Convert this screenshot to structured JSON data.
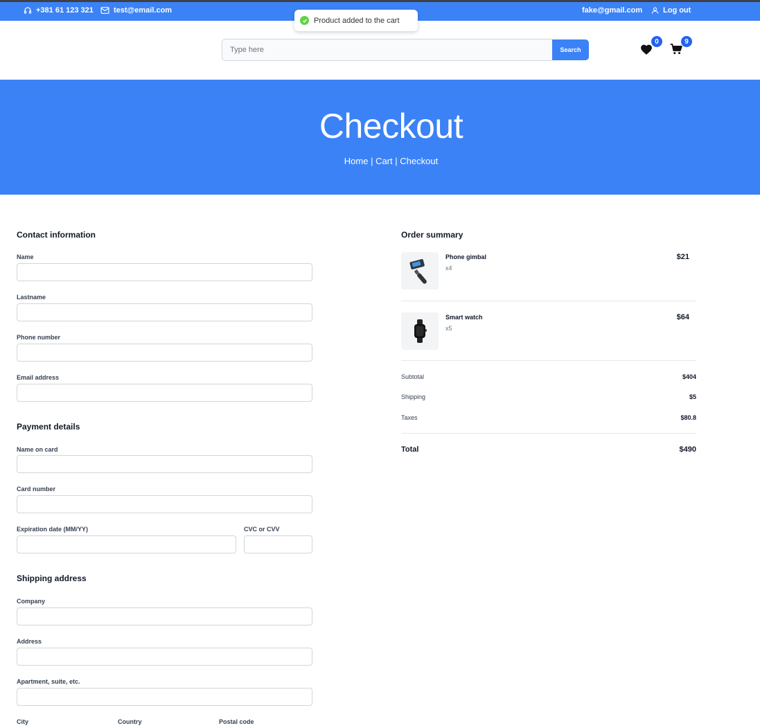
{
  "topbar": {
    "phone": "+381 61 123 321",
    "email": "test@email.com",
    "user_email": "fake@gmail.com",
    "logout": "Log out"
  },
  "toast": {
    "message": "Product added to the cart"
  },
  "search": {
    "placeholder": "Type here",
    "button": "Search"
  },
  "header": {
    "wishlist_count": "0",
    "cart_count": "9"
  },
  "hero": {
    "title": "Checkout",
    "breadcrumb": [
      "Home",
      "Cart",
      "Checkout"
    ],
    "separator": "|"
  },
  "contact": {
    "title": "Contact information",
    "fields": [
      "Name",
      "Lastname",
      "Phone number",
      "Email address"
    ]
  },
  "payment": {
    "title": "Payment details",
    "fields": [
      "Name on card",
      "Card number",
      "Expiration date (MM/YY)",
      "CVC or CVV"
    ]
  },
  "shipping": {
    "title": "Shipping address",
    "fields": [
      "Company",
      "Address",
      "Apartment, suite, etc.",
      "City",
      "Country",
      "Postal code"
    ]
  },
  "order": {
    "title": "Order summary",
    "items": [
      {
        "name": "Phone gimbal",
        "qty": "x4",
        "price": "$21"
      },
      {
        "name": "Smart watch",
        "qty": "x5",
        "price": "$64"
      }
    ],
    "subtotal_label": "Subtotal",
    "subtotal": "$404",
    "shipping_label": "Shipping",
    "shipping": "$5",
    "taxes_label": "Taxes",
    "taxes": "$80.8",
    "total_label": "Total",
    "total": "$490"
  },
  "colors": {
    "primary": "#3b82f6",
    "badge": "#2563eb",
    "toast_check": "#61d345"
  }
}
